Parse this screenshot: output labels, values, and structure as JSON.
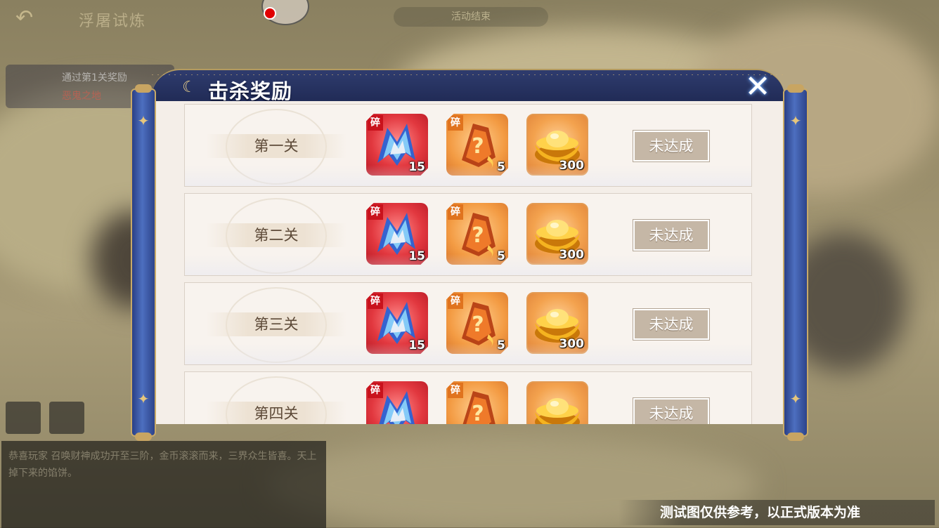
{
  "hud": {
    "back_icon": "back-arrow-icon",
    "stage_title": "浮屠试炼",
    "banner_text": "活动结束",
    "boss_name": "通过第1关奖励",
    "boss_tag": "恶鬼之地"
  },
  "chat": {
    "text": "恭喜玩家 召唤财神成功开至三阶，金币滚滚而来，三界众生皆喜。天上掉下来的馅饼。"
  },
  "modal": {
    "title": "击杀奖励",
    "title_icon": "moon-icon",
    "close_label": "✕",
    "rows": [
      {
        "stage": "第一关",
        "rewards": [
          {
            "kind": "shard",
            "tag": "碎",
            "qty": "15"
          },
          {
            "kind": "mystery-shard",
            "tag": "碎",
            "qty": "5"
          },
          {
            "kind": "gold-ingot",
            "qty": "300"
          }
        ],
        "status": "未达成"
      },
      {
        "stage": "第二关",
        "rewards": [
          {
            "kind": "shard",
            "tag": "碎",
            "qty": "15"
          },
          {
            "kind": "mystery-shard",
            "tag": "碎",
            "qty": "5"
          },
          {
            "kind": "gold-ingot",
            "qty": "300"
          }
        ],
        "status": "未达成"
      },
      {
        "stage": "第三关",
        "rewards": [
          {
            "kind": "shard",
            "tag": "碎",
            "qty": "15"
          },
          {
            "kind": "mystery-shard",
            "tag": "碎",
            "qty": "5"
          },
          {
            "kind": "gold-ingot",
            "qty": "300"
          }
        ],
        "status": "未达成"
      },
      {
        "stage": "第四关",
        "rewards": [
          {
            "kind": "shard",
            "tag": "碎",
            "qty": ""
          },
          {
            "kind": "mystery-shard",
            "tag": "碎",
            "qty": ""
          },
          {
            "kind": "gold-ingot",
            "qty": ""
          }
        ],
        "status": "未达成"
      }
    ]
  },
  "disclaimer": "测试图仅供参考，以正式版本为准",
  "colors": {
    "header_navy": "#1e2852",
    "roller_blue": "#3a58a8",
    "paper": "#f4eee8",
    "status_button": "#c5b7a6",
    "red_shard": "#e2383f",
    "orange_shard": "#f39b43"
  }
}
